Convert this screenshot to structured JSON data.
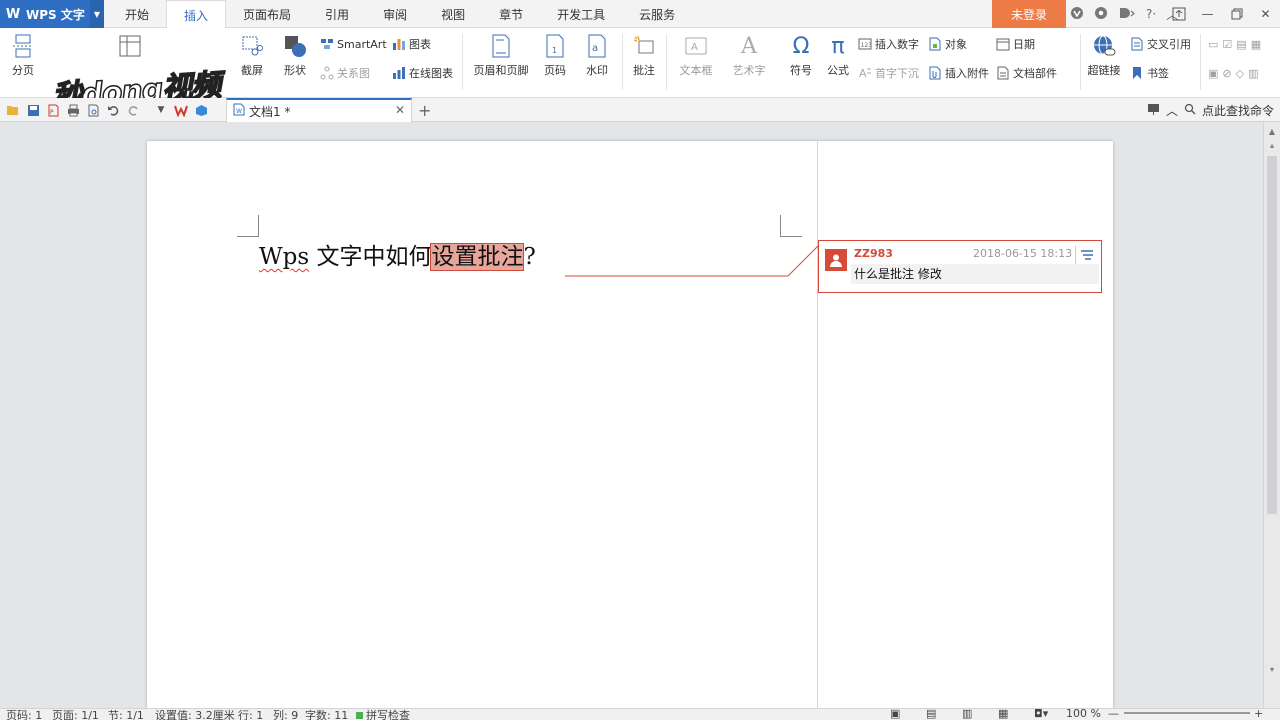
{
  "titlebar": {
    "app_name": "WPS 文字",
    "app_logo": "W",
    "tabs": [
      {
        "label": "开始"
      },
      {
        "label": "插入",
        "active": true
      },
      {
        "label": "页面布局"
      },
      {
        "label": "引用"
      },
      {
        "label": "审阅"
      },
      {
        "label": "视图"
      },
      {
        "label": "章节"
      },
      {
        "label": "开发工具"
      },
      {
        "label": "云服务"
      }
    ],
    "login_label": "未登录",
    "login_color": "#ec7b45",
    "accent_color": "#2f6fc3"
  },
  "ribbon": {
    "page_break": "分页",
    "screenshot": "截屏",
    "shapes": "形状",
    "smartart": "SmartArt",
    "chart": "图表",
    "relation": "关系图",
    "online_chart": "在线图表",
    "header_footer": "页眉和页脚",
    "page_number": "页码",
    "watermark": "水印",
    "comment": "批注",
    "textbox": "文本框",
    "wordart": "艺术字",
    "symbol": "符号",
    "formula": "公式",
    "insert_number": "插入数字",
    "object": "对象",
    "date": "日期",
    "dropcap": "首字下沉",
    "attachment": "插入附件",
    "doc_parts": "文档部件",
    "hyperlink": "超链接",
    "cross_ref": "交叉引用",
    "bookmark": "书签",
    "overlay_logo": "秒dong视频"
  },
  "quickbar": {
    "doc_tab": "文档1 *",
    "find_command": "点此查找命令"
  },
  "document": {
    "text_before": "Wps",
    "text_mid": " 文字中如何",
    "text_highlight": "设置批注",
    "text_after": "?"
  },
  "comment": {
    "author": "ZZ983",
    "time": "2018-06-15 18:13",
    "body": "什么是批注 修改",
    "border_color": "#d24b3a"
  },
  "statusbar": {
    "page_num": "页码: 1",
    "pages": "页面: 1/1",
    "section": "节: 1/1",
    "setting": "设置值: 3.2厘米",
    "row": "行: 1",
    "col": "列: 9",
    "word_count": "字数: 11",
    "spellcheck": "拼写检查",
    "zoom": "100 %"
  }
}
